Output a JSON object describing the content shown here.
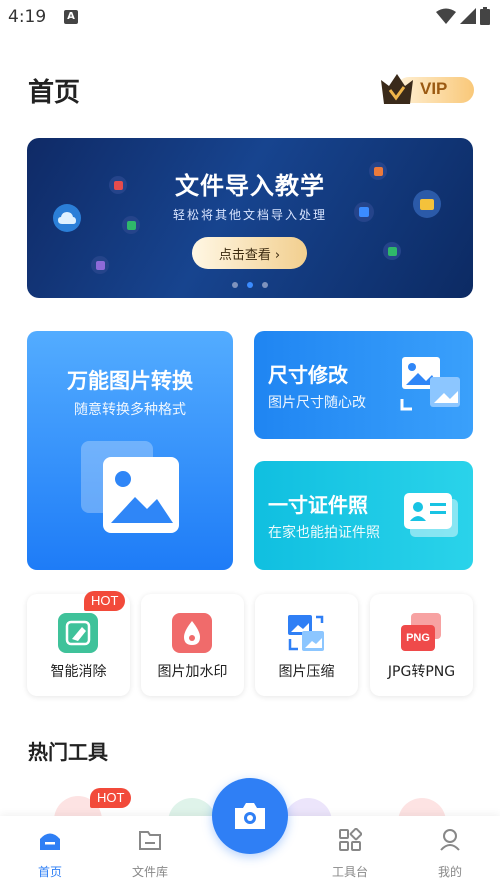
{
  "status_bar": {
    "time": "4:19",
    "notification_icon": "A"
  },
  "header": {
    "title": "首页",
    "vip_label": "VIP"
  },
  "banner": {
    "title": "文件导入教学",
    "subtitle": "轻松将其他文档导入处理",
    "button_label": "点击查看",
    "pages": 3,
    "active_page": 2
  },
  "feature_cards": [
    {
      "title": "万能图片转换",
      "subtitle": "随意转换多种格式",
      "icon": "image-convert-icon"
    },
    {
      "title": "尺寸修改",
      "subtitle": "图片尺寸随心改",
      "icon": "image-resize-icon"
    },
    {
      "title": "一寸证件照",
      "subtitle": "在家也能拍证件照",
      "icon": "id-card-icon"
    }
  ],
  "tools": [
    {
      "label": "智能消除",
      "icon": "eraser-icon",
      "badge": "HOT"
    },
    {
      "label": "图片加水印",
      "icon": "watermark-icon"
    },
    {
      "label": "图片压缩",
      "icon": "compress-icon"
    },
    {
      "label": "JPG转PNG",
      "icon": "png-icon",
      "icon_text": "PNG"
    }
  ],
  "hot_tools": {
    "title": "热门工具",
    "badge": "HOT"
  },
  "tab_bar": {
    "items": [
      {
        "label": "首页",
        "icon": "home-icon",
        "active": true
      },
      {
        "label": "文件库",
        "icon": "folder-icon",
        "active": false
      },
      {
        "label": "工具台",
        "icon": "tools-grid-icon",
        "active": false
      },
      {
        "label": "我的",
        "icon": "profile-icon",
        "active": false
      }
    ],
    "center_icon": "camera-icon"
  },
  "colors": {
    "accent": "#2f7ff5",
    "hot": "#f24a3a",
    "banner_bg": "#17448f"
  }
}
